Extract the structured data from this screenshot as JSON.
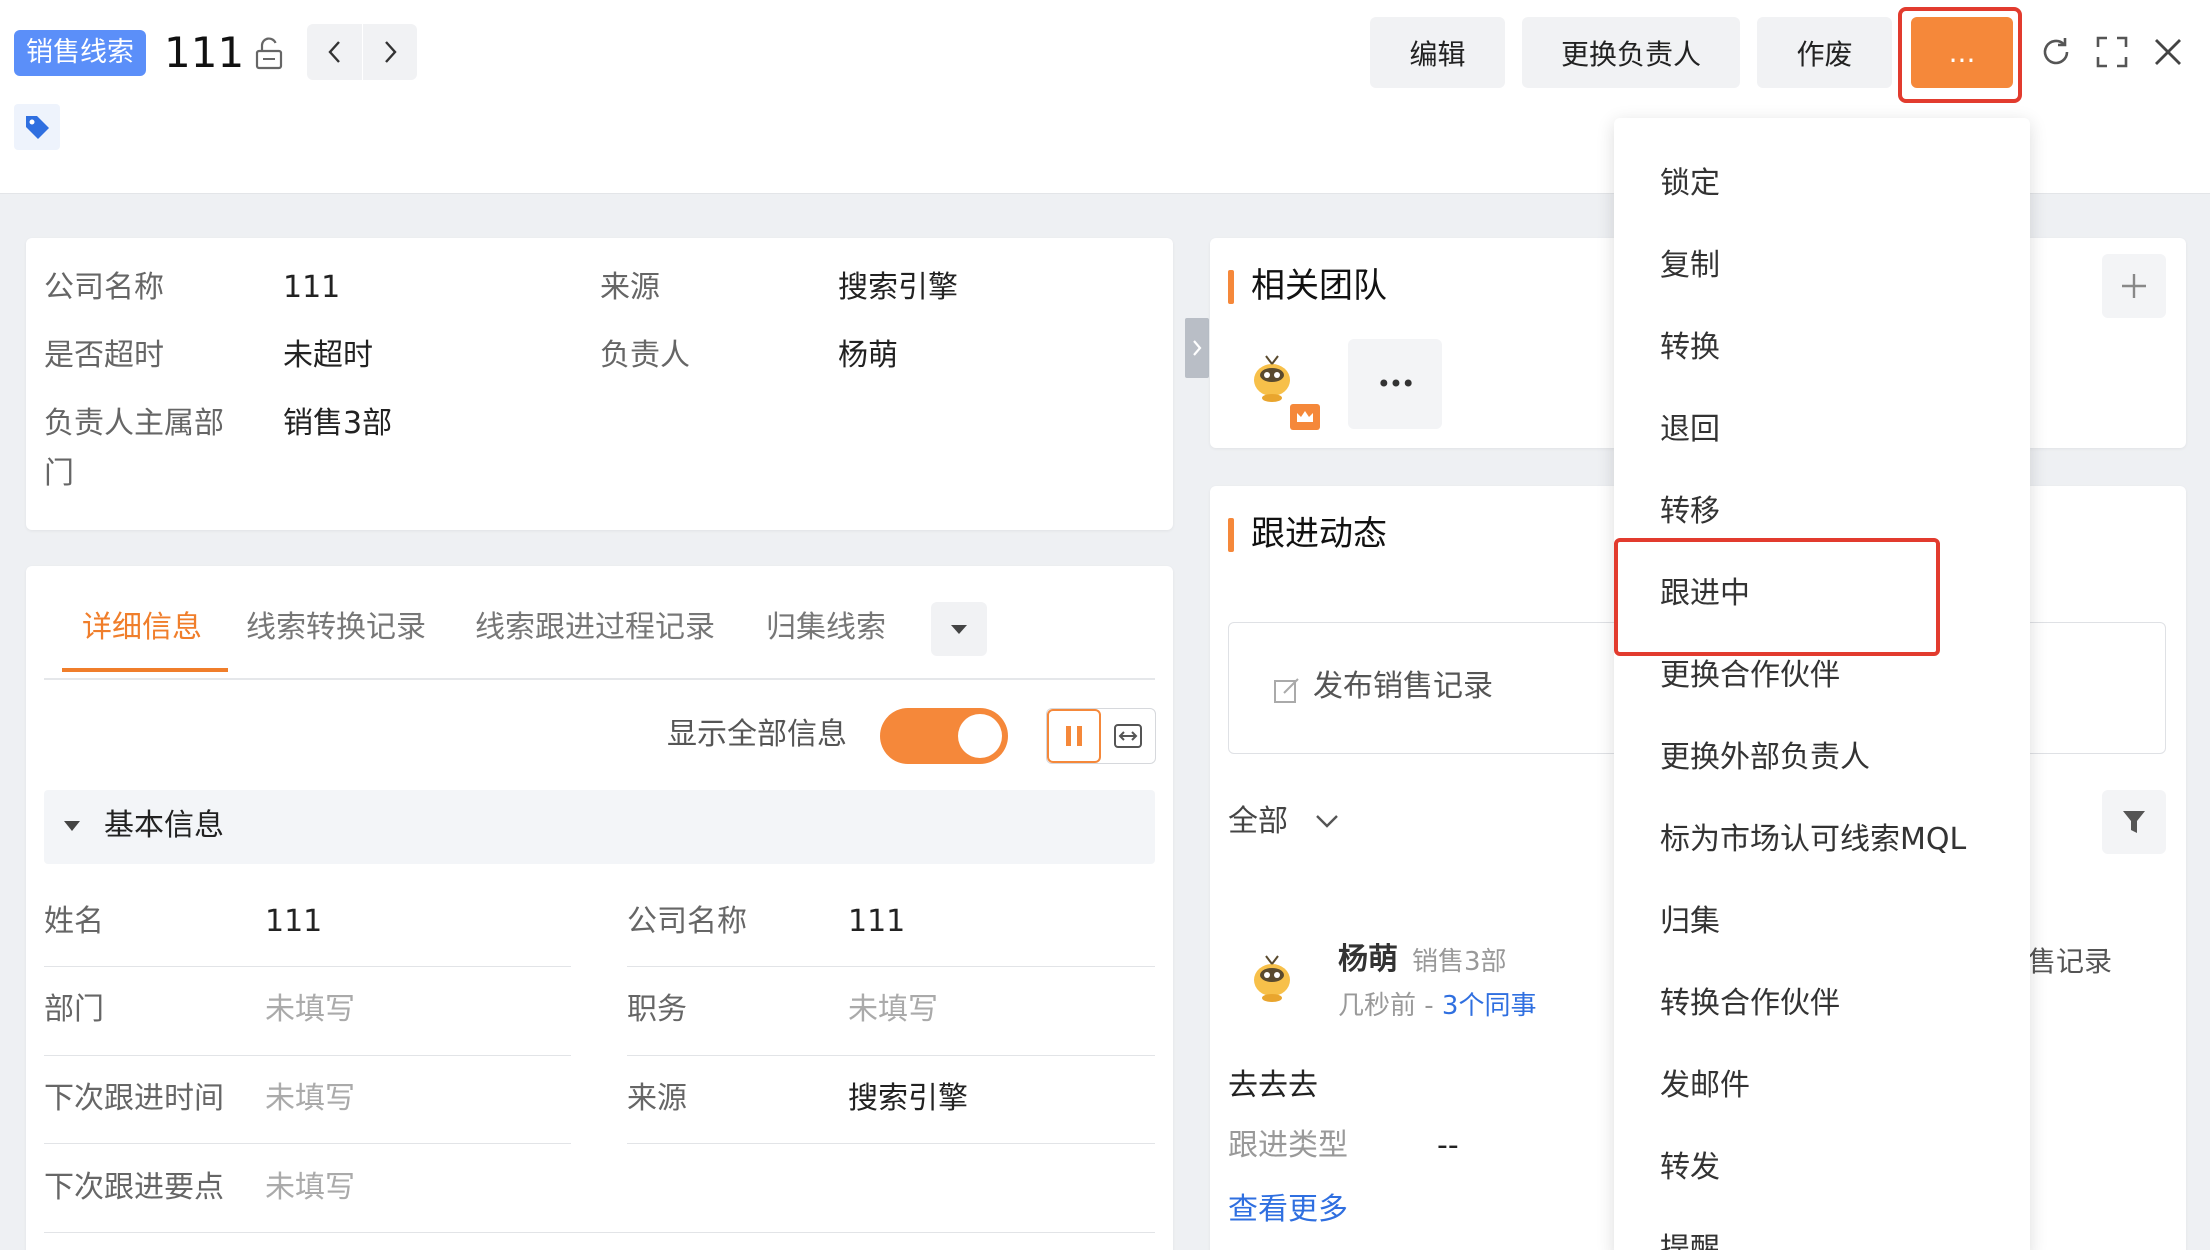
{
  "header": {
    "badge": "销售线索",
    "title": "111",
    "buttons": {
      "edit": "编辑",
      "change_owner": "更换负责人",
      "void": "作废",
      "more": "..."
    }
  },
  "summary": {
    "company_label": "公司名称",
    "company_value": "111",
    "source_label": "来源",
    "source_value": "搜索引擎",
    "overtime_label": "是否超时",
    "overtime_value": "未超时",
    "owner_label": "负责人",
    "owner_value": "杨萌",
    "dept_label_1": "负责人主属部",
    "dept_label_2": "门",
    "dept_value": "销售3部"
  },
  "tabs": {
    "items": [
      "详细信息",
      "线索转换记录",
      "线索跟进过程记录",
      "归集线索"
    ]
  },
  "toolbar": {
    "show_all_label": "显示全部信息"
  },
  "basic": {
    "section_title": "基本信息",
    "fields": [
      {
        "label": "姓名",
        "value": "111"
      },
      {
        "label": "公司名称",
        "value": "111"
      },
      {
        "label": "部门",
        "value": "未填写"
      },
      {
        "label": "职务",
        "value": "未填写"
      },
      {
        "label": "下次跟进时间",
        "value": "未填写"
      },
      {
        "label": "来源",
        "value": "搜索引擎"
      },
      {
        "label": "下次跟进要点",
        "value": "未填写"
      }
    ]
  },
  "team": {
    "title": "相关团队",
    "more": "•••"
  },
  "followup": {
    "title": "跟进动态",
    "post_placeholder": "发布销售记录",
    "filter_label": "全部",
    "user_name": "杨萌",
    "user_dept": "销售3部",
    "time": "几秒前 - ",
    "colleagues": "3个同事",
    "right_fragment": "售记录",
    "content": "去去去",
    "type_label": "跟进类型",
    "type_value": "--",
    "see_more": "查看更多"
  },
  "menu": {
    "items": [
      "锁定",
      "复制",
      "转换",
      "退回",
      "转移",
      "跟进中",
      "更换合作伙伴",
      "更换外部负责人",
      "标为市场认可线索MQL",
      "归集",
      "转换合作伙伴",
      "发邮件",
      "转发",
      "提醒"
    ]
  },
  "colors": {
    "accent": "#f5883a",
    "brand_blue": "#5b8ff9",
    "highlight_red": "#e23b2e"
  }
}
